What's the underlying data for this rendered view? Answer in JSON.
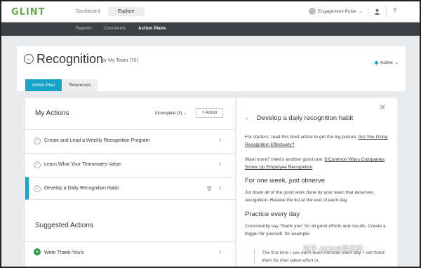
{
  "app": {
    "logo": "GLINT",
    "nav": [
      "Dashboard",
      "Explore"
    ],
    "engagement": "Engagement Pulse",
    "help": "?"
  },
  "subnav": [
    "Reports",
    "Comments",
    "Action Plans"
  ],
  "page": {
    "title": "Recognition",
    "subtitle": "for My Team (70)",
    "status": "Active"
  },
  "tabs": [
    "Action Plan",
    "Resources"
  ],
  "my_actions": {
    "heading": "My Actions",
    "filter": "Incomplete (3)",
    "add_label": "Action",
    "items": [
      {
        "label": "Create and Lead a Weekly Recognition Program"
      },
      {
        "label": "Learn What Your Teammates Value"
      },
      {
        "label": "Develop a Daily Recognition Habit"
      }
    ]
  },
  "suggested": {
    "heading": "Suggested Actions",
    "items": [
      {
        "label": "Write Thank-You's"
      }
    ]
  },
  "detail": {
    "title": "Develop a daily recognition habit",
    "p1_text": "For starters, read this brief article to get the big picture: ",
    "p1_link": "Are You Using Recognition Effectively?",
    "p2_text": "Want more? Here's another good one: ",
    "p2_link": "8 Common Ways Companies Screw Up Employee Recognition",
    "h1": "For one week, just observe",
    "p3": "Jot down all of the good work done by your team that deserves recognition. Review the list at the end of each day.",
    "h2": "Practice every day",
    "p4": "Consistently say \"thank you\" for all good efforts and results. Create a trigger for yourself, for example:",
    "quote": "The first time I see each team member each day, I will thank them for their latest effort or"
  },
  "watermark": "知乎 @DHR赛武院",
  "colors": {
    "accent": "#1aa3c9",
    "green": "#2e9a4a",
    "subnav_bg": "#3d4044"
  }
}
